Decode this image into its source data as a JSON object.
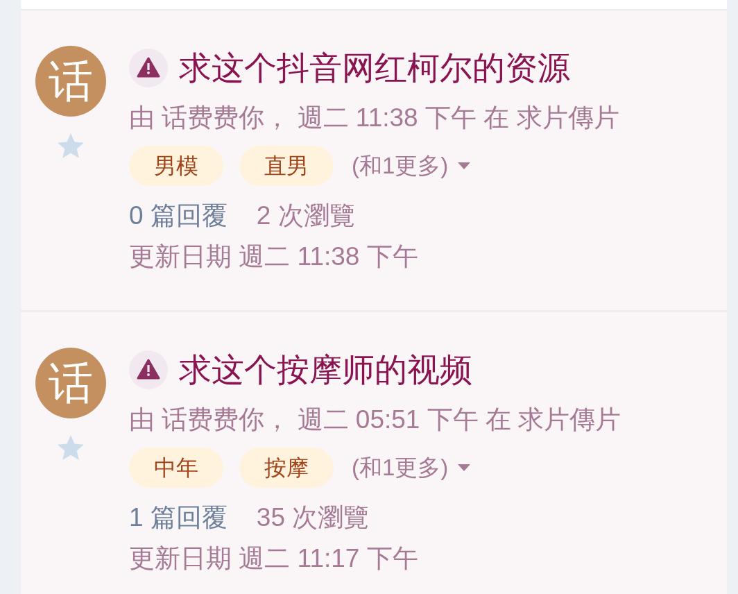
{
  "topics": [
    {
      "avatar_letter": "话",
      "starred": false,
      "title": "求这个抖音网红柯尔的资源",
      "meta": "由 话费费你， 週二 11:38 下午 在 求片傳片",
      "tags": [
        "男模",
        "直男"
      ],
      "more_tags": "(和1更多)",
      "replies": "0 篇回覆",
      "views": "2 次瀏覽",
      "updated": "更新日期 週二 11:38 下午"
    },
    {
      "avatar_letter": "话",
      "starred": false,
      "title": "求这个按摩师的视频",
      "meta": "由 话费费你， 週二 05:51 下午 在 求片傳片",
      "tags": [
        "中年",
        "按摩"
      ],
      "more_tags": "(和1更多)",
      "replies": "1 篇回覆",
      "views": "35 次瀏覽",
      "updated": "更新日期 週二 11:17 下午"
    }
  ]
}
